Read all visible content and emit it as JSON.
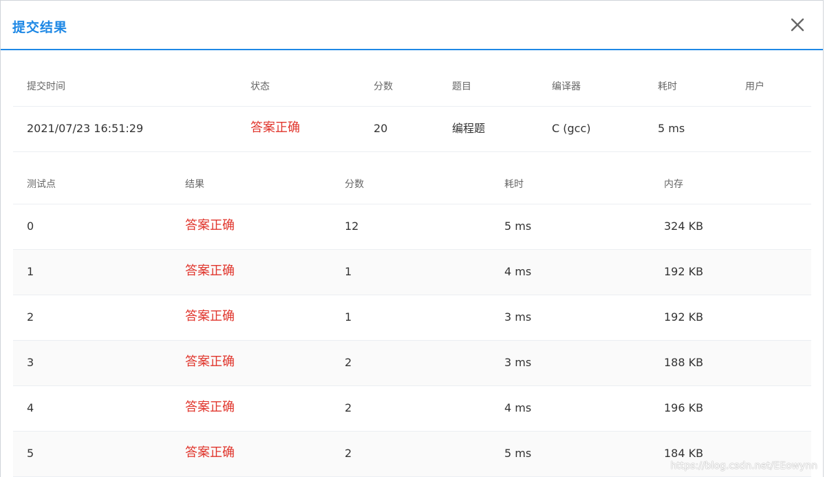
{
  "dialog": {
    "title": "提交结果",
    "close_icon": "close-icon"
  },
  "summary": {
    "headers": [
      "提交时间",
      "状态",
      "分数",
      "题目",
      "编译器",
      "耗时",
      "用户"
    ],
    "row": {
      "time": "2021/07/23 16:51:29",
      "status": "答案正确",
      "score": "20",
      "problem": "编程题",
      "compiler": "C (gcc)",
      "duration": "5 ms",
      "user": ""
    }
  },
  "testcases": {
    "headers": [
      "测试点",
      "结果",
      "分数",
      "耗时",
      "内存"
    ],
    "rows": [
      {
        "id": "0",
        "result": "答案正确",
        "score": "12",
        "time": "5 ms",
        "memory": "324 KB"
      },
      {
        "id": "1",
        "result": "答案正确",
        "score": "1",
        "time": "4 ms",
        "memory": "192 KB"
      },
      {
        "id": "2",
        "result": "答案正确",
        "score": "1",
        "time": "3 ms",
        "memory": "192 KB"
      },
      {
        "id": "3",
        "result": "答案正确",
        "score": "2",
        "time": "3 ms",
        "memory": "188 KB"
      },
      {
        "id": "4",
        "result": "答案正确",
        "score": "2",
        "time": "4 ms",
        "memory": "196 KB"
      },
      {
        "id": "5",
        "result": "答案正确",
        "score": "2",
        "time": "5 ms",
        "memory": "184 KB"
      }
    ]
  },
  "colors": {
    "accent": "#1e88e5",
    "success_text": "#e0342b"
  },
  "watermark": "https://blog.csdn.net/EEowynn"
}
